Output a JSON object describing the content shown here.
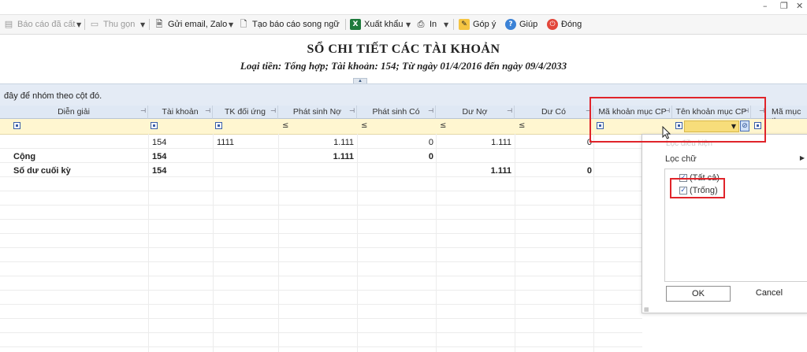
{
  "window": {
    "controls": [
      "–",
      "❐",
      "✕"
    ]
  },
  "toolbar": {
    "items": [
      {
        "label": "Báo cáo đã cất",
        "icon": "save-report-icon",
        "disabled": true
      },
      {
        "label": "Thu gọn",
        "icon": "collapse-icon",
        "disabled": true
      },
      {
        "label": "Gửi email, Zalo",
        "icon": "document-icon"
      },
      {
        "label": "Tạo báo cáo song ngữ",
        "icon": "document-edit-icon"
      },
      {
        "label": "Xuất khẩu",
        "icon": "excel-icon"
      },
      {
        "label": "In",
        "icon": "printer-icon"
      },
      {
        "label": "Góp ý",
        "icon": "feedback-icon"
      },
      {
        "label": "Giúp",
        "icon": "help-icon"
      },
      {
        "label": "Đóng",
        "icon": "power-icon"
      }
    ]
  },
  "report": {
    "title": "SỔ CHI TIẾT CÁC TÀI KHOẢN",
    "subtitle": "Loại tiền: Tổng hợp; Tài khoản: 154; Từ ngày 01/4/2016 đến ngày 09/4/2033"
  },
  "grid": {
    "group_hint": "đây để nhóm theo cột đó.",
    "columns": [
      "Diễn giải",
      "Tài khoản",
      "TK đối ứng",
      "Phát sinh Nợ",
      "Phát sinh Có",
      "Dư Nợ",
      "Dư Có",
      "Mã khoản mục CP",
      "Tên khoản mục CP",
      "Mã mục th"
    ],
    "filter_ops": [
      "≤",
      "≤",
      "≤",
      "≤"
    ],
    "rows": [
      {
        "dien_giai": "",
        "tai_khoan": "154",
        "tk_doi_ung": "1111",
        "ps_no": "1.111",
        "ps_co": "0",
        "du_no": "1.111",
        "du_co": "0",
        "bold": false
      },
      {
        "dien_giai": "Cộng",
        "tai_khoan": "154",
        "tk_doi_ung": "",
        "ps_no": "1.111",
        "ps_co": "0",
        "du_no": "",
        "du_co": "",
        "bold": true
      },
      {
        "dien_giai": "Số dư cuối kỳ",
        "tai_khoan": "154",
        "tk_doi_ung": "",
        "ps_no": "",
        "ps_co": "",
        "du_no": "1.111",
        "du_co": "0",
        "bold": true
      }
    ]
  },
  "filter_popup": {
    "faded_label": "Lọc điều kiện",
    "menu_label": "Lọc chữ",
    "options": [
      {
        "label": "(Tất cả)",
        "checked": true
      },
      {
        "label": "(Trống)",
        "checked": true
      }
    ],
    "ok_label": "OK",
    "cancel_label": "Cancel"
  },
  "colors": {
    "accent_red": "#e0242a",
    "header_bg": "#dfe8f4",
    "filter_row_bg": "#fff6d0"
  }
}
